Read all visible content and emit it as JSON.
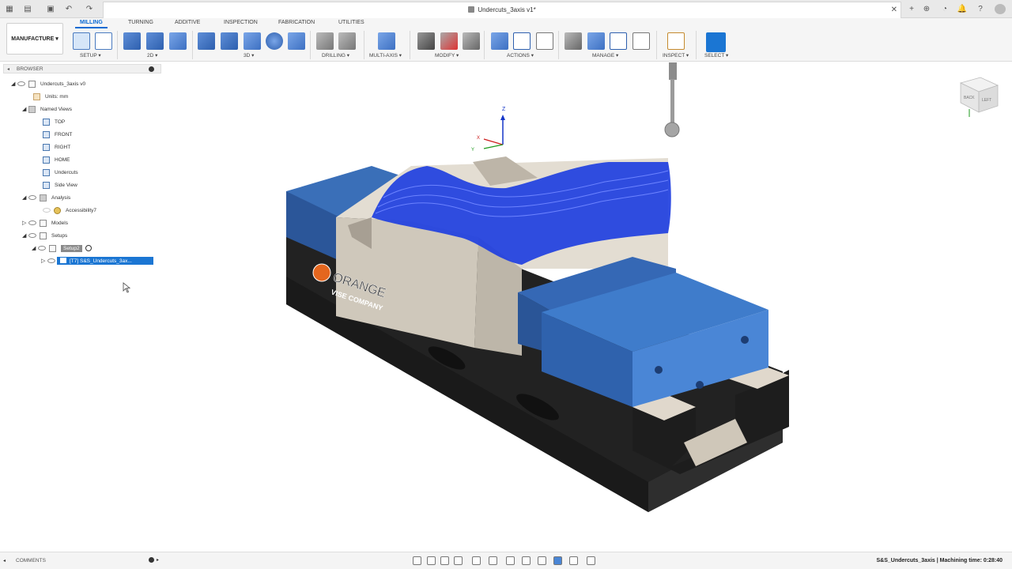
{
  "window": {
    "title": "Undercuts_3axis v1*"
  },
  "workspace": {
    "label": "MANUFACTURE"
  },
  "tabs": [
    {
      "label": "MILLING",
      "active": true
    },
    {
      "label": "TURNING",
      "active": false
    },
    {
      "label": "ADDITIVE",
      "active": false
    },
    {
      "label": "INSPECTION",
      "active": false
    },
    {
      "label": "FABRICATION",
      "active": false
    },
    {
      "label": "UTILITIES",
      "active": false
    }
  ],
  "ribbon_groups": [
    {
      "label": "SETUP"
    },
    {
      "label": "2D"
    },
    {
      "label": "3D"
    },
    {
      "label": "DRILLING"
    },
    {
      "label": "MULTI-AXIS"
    },
    {
      "label": "MODIFY"
    },
    {
      "label": "ACTIONS"
    },
    {
      "label": "MANAGE"
    },
    {
      "label": "INSPECT"
    },
    {
      "label": "SELECT"
    }
  ],
  "browser": {
    "header": "BROWSER",
    "root": "Undercuts_3axis v0",
    "units": "Units: mm",
    "named_views_label": "Named Views",
    "views": [
      "TOP",
      "FRONT",
      "RIGHT",
      "HOME",
      "Undercuts",
      "Side View"
    ],
    "analysis": "Analysis",
    "accessibility": "Accessibility7",
    "models": "Models",
    "setups": "Setups",
    "setup": "Setup2",
    "operation": "[T7] S&S_Undercuts_3ax..."
  },
  "viewport": {
    "brand_line1": "ORANGE",
    "brand_line2": "VISE COMPANY",
    "axis_z": "Z",
    "axis_x": "X",
    "axis_y": "Y",
    "viewcube_back": "BACK",
    "viewcube_left": "LEFT",
    "toolpath_color": "#1f3fe0",
    "jaw_color": "#3a72c4",
    "body_color": "#222222",
    "stock_color": "#d9d2c6"
  },
  "bottombar": {
    "comments": "COMMENTS",
    "status": "S&S_Undercuts_3axis | Machining time: 0:28:40"
  }
}
